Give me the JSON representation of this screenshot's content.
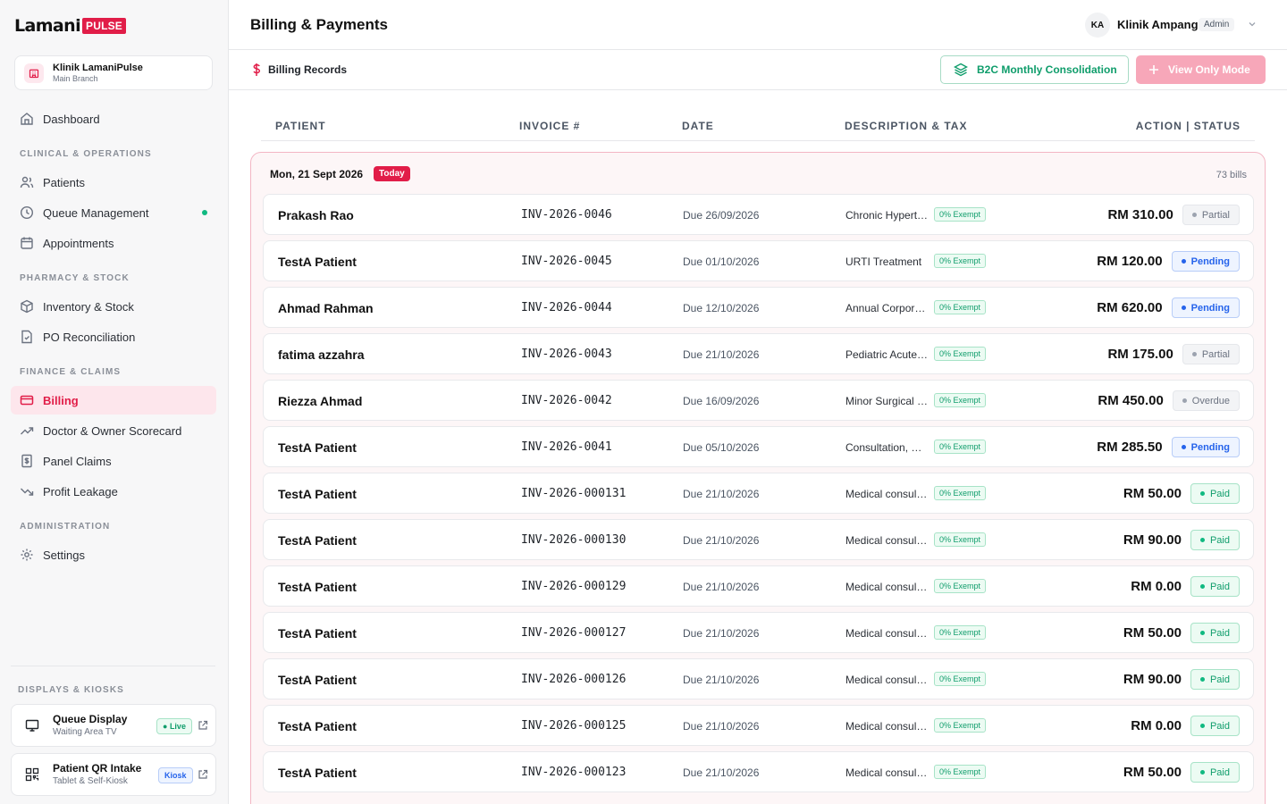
{
  "brand": {
    "word": "Lamani",
    "pulse": "PULSE"
  },
  "clinic": {
    "name": "Klinik LamaniPulse",
    "branch": "Main Branch"
  },
  "nav": {
    "dashboard": "Dashboard",
    "section_clinical": "CLINICAL & OPERATIONS",
    "patients": "Patients",
    "queue": "Queue Management",
    "appointments": "Appointments",
    "section_pharmacy": "PHARMACY & STOCK",
    "inventory": "Inventory & Stock",
    "po": "PO Reconciliation",
    "section_finance": "FINANCE & CLAIMS",
    "billing": "Billing",
    "scorecard": "Doctor & Owner Scorecard",
    "panel": "Panel Claims",
    "leakage": "Profit Leakage",
    "section_admin": "ADMINISTRATION",
    "settings": "Settings",
    "section_displays": "DISPLAYS & KIOSKS"
  },
  "kiosks": {
    "queue_display": {
      "title": "Queue Display",
      "sub": "Waiting Area TV",
      "badge": "Live"
    },
    "qr_intake": {
      "title": "Patient QR Intake",
      "sub": "Tablet & Self-Kiosk",
      "badge": "Kiosk"
    }
  },
  "header": {
    "title": "Billing & Payments",
    "user_initials": "KA",
    "user_name": "Klinik Ampang",
    "role": "Admin"
  },
  "subbar": {
    "title": "Billing Records",
    "consolidation": "B2C Monthly Consolidation",
    "view_only": "View Only Mode"
  },
  "table": {
    "headers": {
      "patient": "PATIENT",
      "invoice": "INVOICE #",
      "date": "DATE",
      "description": "DESCRIPTION & TAX",
      "action": "ACTION | STATUS"
    },
    "group": {
      "date": "Mon, 21 Sept 2026",
      "badge": "Today",
      "count": "73 bills"
    },
    "rows": [
      {
        "patient": "Prakash Rao",
        "invoice": "INV-2026-0046",
        "due": "Due 26/09/2026",
        "desc": "Chronic Hypertension Review",
        "tax": "0% Exempt",
        "amount": "RM 310.00",
        "status": "Partial",
        "status_type": "partial"
      },
      {
        "patient": "TestA Patient",
        "invoice": "INV-2026-0045",
        "due": "Due 01/10/2026",
        "desc": "URTI Treatment",
        "tax": "0% Exempt",
        "amount": "RM 120.00",
        "status": "Pending",
        "status_type": "pending"
      },
      {
        "patient": "Ahmad Rahman",
        "invoice": "INV-2026-0044",
        "due": "Due 12/10/2026",
        "desc": "Annual Corporate Checkup",
        "tax": "0% Exempt",
        "amount": "RM 620.00",
        "status": "Pending",
        "status_type": "pending"
      },
      {
        "patient": "fatima azzahra",
        "invoice": "INV-2026-0043",
        "due": "Due 21/10/2026",
        "desc": "Pediatric Acute Fever",
        "tax": "0% Exempt",
        "amount": "RM 175.00",
        "status": "Partial",
        "status_type": "partial"
      },
      {
        "patient": "Riezza Ahmad",
        "invoice": "INV-2026-0042",
        "due": "Due 16/09/2026",
        "desc": "Minor Surgical Procedure",
        "tax": "0% Exempt",
        "amount": "RM 450.00",
        "status": "Overdue",
        "status_type": "overdue"
      },
      {
        "patient": "TestA Patient",
        "invoice": "INV-2026-0041",
        "due": "Due 05/10/2026",
        "desc": "Consultation, Medication",
        "tax": "0% Exempt",
        "amount": "RM 285.50",
        "status": "Pending",
        "status_type": "pending"
      },
      {
        "patient": "TestA Patient",
        "invoice": "INV-2026-000131",
        "due": "Due 21/10/2026",
        "desc": "Medical consultation",
        "tax": "0% Exempt",
        "amount": "RM 50.00",
        "status": "Paid",
        "status_type": "paid"
      },
      {
        "patient": "TestA Patient",
        "invoice": "INV-2026-000130",
        "due": "Due 21/10/2026",
        "desc": "Medical consultation",
        "tax": "0% Exempt",
        "amount": "RM 90.00",
        "status": "Paid",
        "status_type": "paid"
      },
      {
        "patient": "TestA Patient",
        "invoice": "INV-2026-000129",
        "due": "Due 21/10/2026",
        "desc": "Medical consultation",
        "tax": "0% Exempt",
        "amount": "RM 0.00",
        "status": "Paid",
        "status_type": "paid"
      },
      {
        "patient": "TestA Patient",
        "invoice": "INV-2026-000127",
        "due": "Due 21/10/2026",
        "desc": "Medical consultation",
        "tax": "0% Exempt",
        "amount": "RM 50.00",
        "status": "Paid",
        "status_type": "paid"
      },
      {
        "patient": "TestA Patient",
        "invoice": "INV-2026-000126",
        "due": "Due 21/10/2026",
        "desc": "Medical consultation",
        "tax": "0% Exempt",
        "amount": "RM 90.00",
        "status": "Paid",
        "status_type": "paid"
      },
      {
        "patient": "TestA Patient",
        "invoice": "INV-2026-000125",
        "due": "Due 21/10/2026",
        "desc": "Medical consultation",
        "tax": "0% Exempt",
        "amount": "RM 0.00",
        "status": "Paid",
        "status_type": "paid"
      },
      {
        "patient": "TestA Patient",
        "invoice": "INV-2026-000123",
        "due": "Due 21/10/2026",
        "desc": "Medical consultation",
        "tax": "0% Exempt",
        "amount": "RM 50.00",
        "status": "Paid",
        "status_type": "paid"
      }
    ]
  },
  "colors": {
    "accent": "#e11d48",
    "success": "#10b981",
    "pending": "#2563eb"
  }
}
